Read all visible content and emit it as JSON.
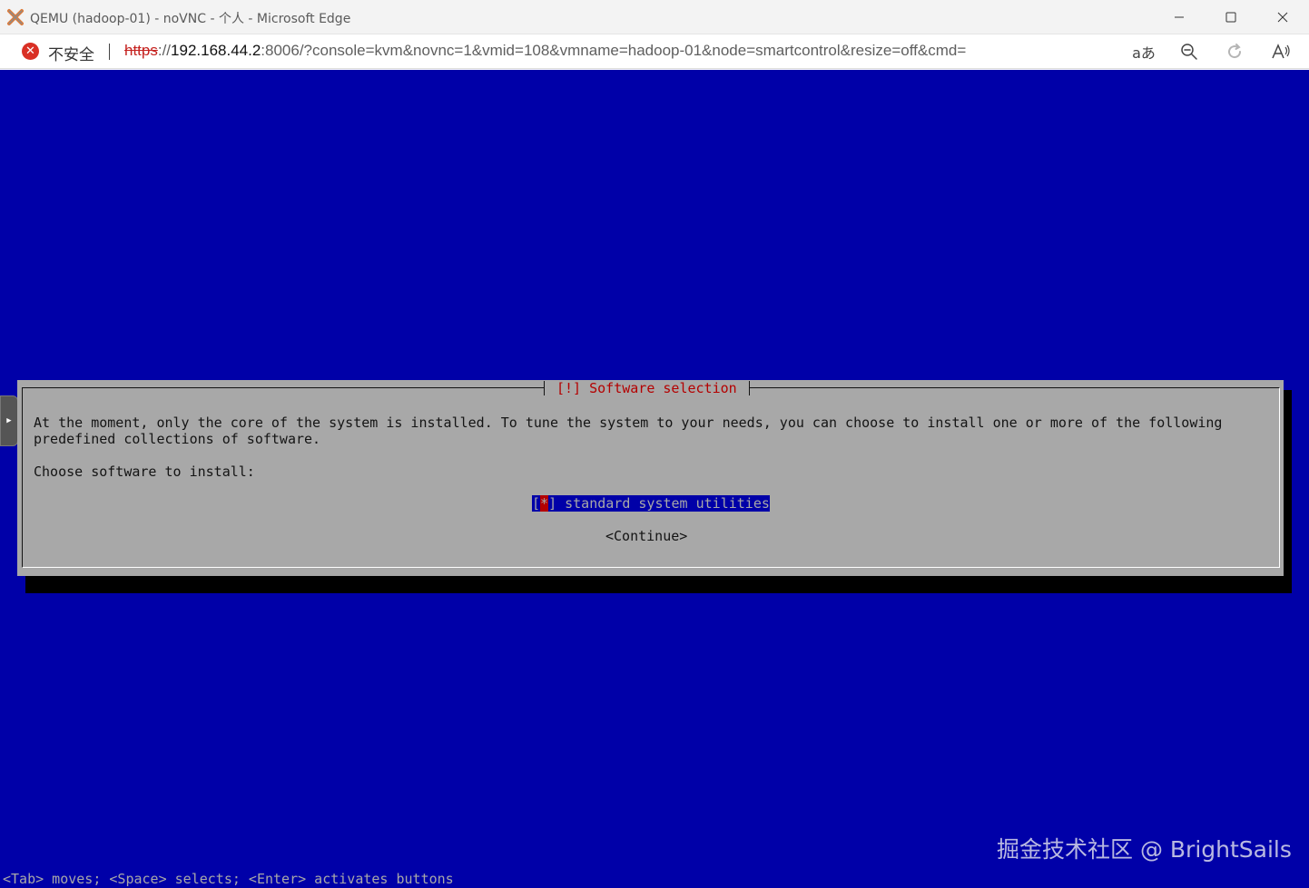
{
  "window": {
    "title": "QEMU (hadoop-01) - noVNC - 个人 - Microsoft Edge"
  },
  "addressbar": {
    "security_label": "不安全",
    "url_protocol": "https",
    "url_sep": "://",
    "url_host": "192.168.44.2",
    "url_rest": ":8006/?console=kvm&novnc=1&vmid=108&vmname=hadoop-01&node=smartcontrol&resize=off&cmd=",
    "translate_glyph": "aあ",
    "read_aloud_glyph": "Á"
  },
  "installer": {
    "dialog_title": "[!] Software selection",
    "description_line1": "At the moment, only the core of the system is installed. To tune the system to your needs, you can choose to install one or more of the following",
    "description_line2": "predefined collections of software.",
    "prompt": "Choose software to install:",
    "option_bracket_open": "[",
    "option_mark": "*",
    "option_bracket_close": "]",
    "option_label": " standard system utilities",
    "continue_label": "<Continue>",
    "status_line": "<Tab> moves; <Space> selects; <Enter> activates buttons"
  },
  "watermark": "掘金技术社区 @ BrightSails",
  "colors": {
    "vnc_background": "#0000a8",
    "dialog_background": "#a8a8a8",
    "title_red": "#b40000"
  }
}
